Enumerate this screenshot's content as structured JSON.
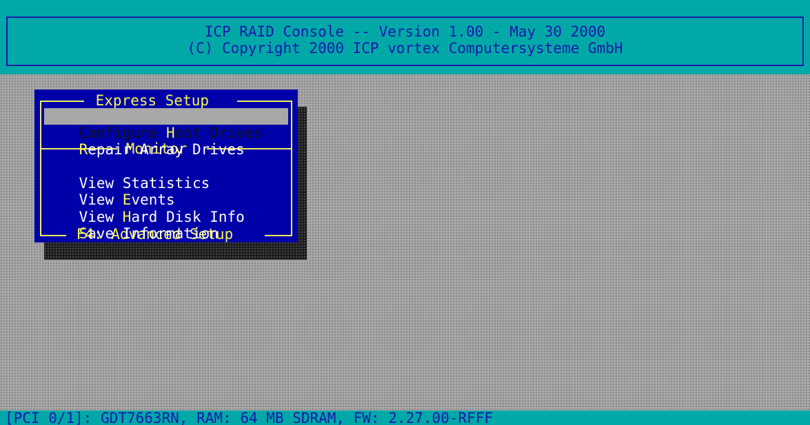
{
  "header": {
    "line1": "ICP RAID Console -- Version 1.00 - May 30 2000",
    "line2": "(C) Copyright 2000 ICP vortex Computersysteme GmbH"
  },
  "menu": {
    "title": " Express Setup ",
    "section_monitor": " Monitor ",
    "footer": " F4: Advanced Setup ",
    "items": [
      {
        "pre": "Configure ",
        "hot": "H",
        "post": "ost Drives",
        "selected": true
      },
      {
        "pre": "",
        "hot": "R",
        "post": "epair Array Drives",
        "selected": false
      },
      {
        "pre": "View Statistics",
        "hot": "",
        "post": "",
        "selected": false
      },
      {
        "pre": "View ",
        "hot": "E",
        "post": "vents",
        "selected": false
      },
      {
        "pre": "View ",
        "hot": "H",
        "post": "ard Disk Info",
        "selected": false
      },
      {
        "pre": "",
        "hot": "S",
        "post": "ave Information",
        "selected": false
      }
    ]
  },
  "status_bar": {
    "text": "[PCI 0/1]: GDT7663RN, RAM: 64 MB SDRAM, FW: 2.27.00-RFFF"
  },
  "colors": {
    "header_bg": "#00a8a8",
    "menu_bg": "#0000a8",
    "highlight_yellow": "#f8f850",
    "selection_bg": "#a8a8a8"
  }
}
